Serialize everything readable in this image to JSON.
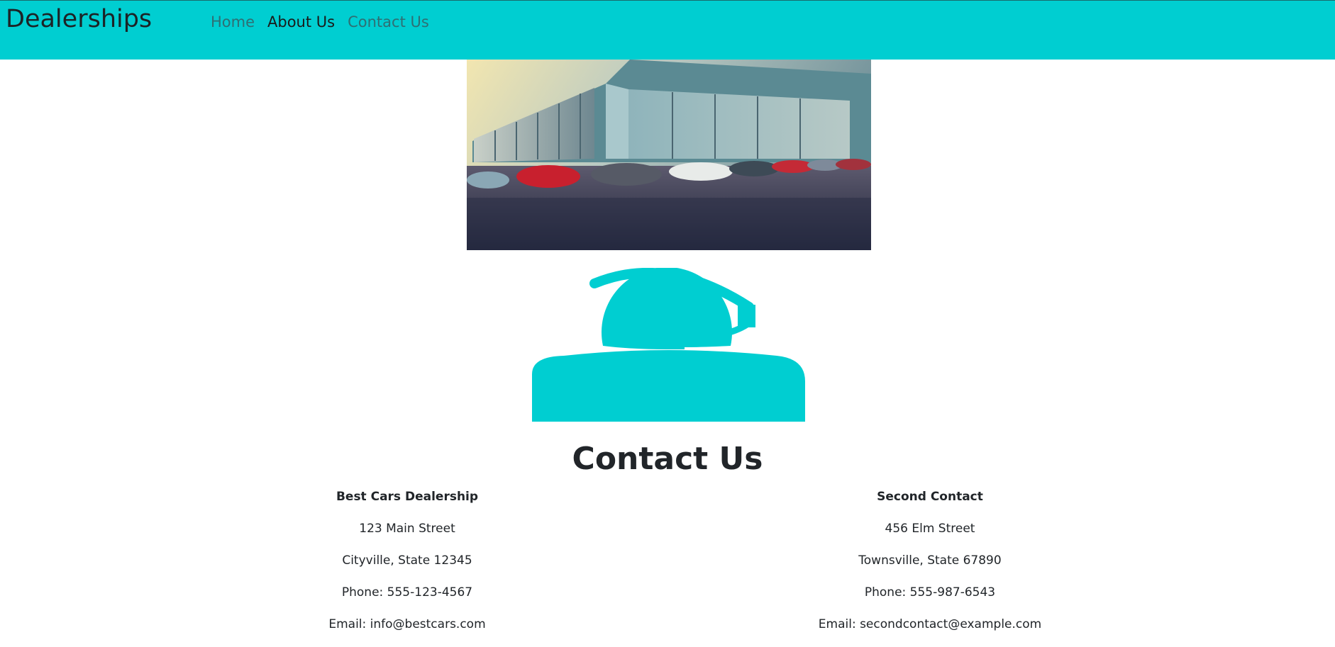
{
  "navbar": {
    "brand": "Dealerships",
    "links": [
      {
        "label": "Home",
        "active": false
      },
      {
        "label": "About Us",
        "active": true
      },
      {
        "label": "Contact Us",
        "active": false
      }
    ],
    "background": "#00ced1"
  },
  "main": {
    "hero_image_icon": "car-dealership-image",
    "support_icon": "customer-support-headset-icon",
    "title": "Contact Us",
    "contacts": [
      {
        "name": "Best Cars Dealership",
        "street": "123 Main Street",
        "city": "Cityville, State 12345",
        "phone": "Phone: 555-123-4567",
        "email": "Email: info@bestcars.com"
      },
      {
        "name": "Second Contact",
        "street": "456 Elm Street",
        "city": "Townsville, State 67890",
        "phone": "Phone: 555-987-6543",
        "email": "Email: secondcontact@example.com"
      }
    ]
  }
}
